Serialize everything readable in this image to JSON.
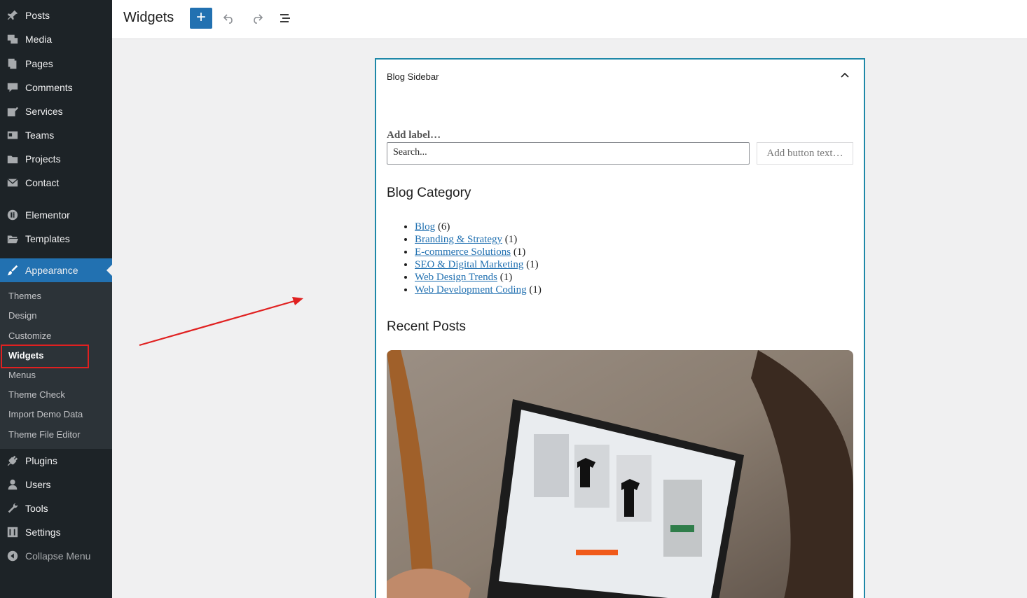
{
  "sidebar": {
    "items": [
      {
        "label": "Posts",
        "icon": "pin-icon"
      },
      {
        "label": "Media",
        "icon": "media-icon"
      },
      {
        "label": "Pages",
        "icon": "pages-icon"
      },
      {
        "label": "Comments",
        "icon": "comments-icon"
      },
      {
        "label": "Services",
        "icon": "edit-icon"
      },
      {
        "label": "Teams",
        "icon": "id-card-icon"
      },
      {
        "label": "Projects",
        "icon": "folder-icon"
      },
      {
        "label": "Contact",
        "icon": "email-icon"
      },
      {
        "label": "Elementor",
        "icon": "elementor-icon"
      },
      {
        "label": "Templates",
        "icon": "folder-open-icon"
      },
      {
        "label": "Appearance",
        "icon": "brush-icon"
      },
      {
        "label": "Plugins",
        "icon": "plugin-icon"
      },
      {
        "label": "Users",
        "icon": "user-icon"
      },
      {
        "label": "Tools",
        "icon": "wrench-icon"
      },
      {
        "label": "Settings",
        "icon": "settings-icon"
      },
      {
        "label": "Collapse Menu",
        "icon": "collapse-icon"
      }
    ],
    "submenu": [
      "Themes",
      "Design",
      "Customize",
      "Widgets",
      "Menus",
      "Theme Check",
      "Import Demo Data",
      "Theme File Editor"
    ],
    "active_menu": "Appearance",
    "active_submenu": "Widgets"
  },
  "header": {
    "title": "Widgets",
    "add_label": "+"
  },
  "widget_area": {
    "title": "Blog Sidebar",
    "search": {
      "label_placeholder": "Add label…",
      "input_placeholder": "Search...",
      "button_placeholder": "Add button text…"
    },
    "category_heading": "Blog Category",
    "categories": [
      {
        "name": "Blog",
        "count": "(6)"
      },
      {
        "name": "Branding & Strategy",
        "count": "(1)"
      },
      {
        "name": "E-commerce Solutions",
        "count": "(1)"
      },
      {
        "name": "SEO & Digital Marketing",
        "count": "(1)"
      },
      {
        "name": "Web Design Trends",
        "count": "(1)"
      },
      {
        "name": "Web Development Coding",
        "count": "(1)"
      }
    ],
    "recent_heading": "Recent Posts"
  },
  "colors": {
    "sidebar_bg": "#1d2327",
    "accent": "#2271b1",
    "highlight": "#e02020",
    "card_border": "#1e88a8"
  }
}
